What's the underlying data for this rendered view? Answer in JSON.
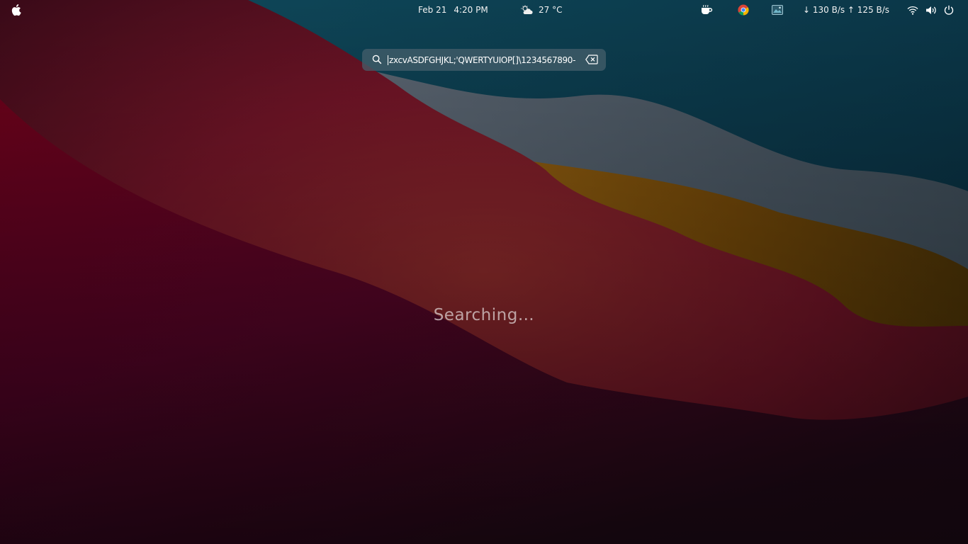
{
  "topbar": {
    "apple_menu_icon": "apple-icon",
    "date": "Feb 21",
    "time": "4:20 PM",
    "weather": {
      "icon": "partly-cloudy-icon",
      "temperature": "27 °C"
    },
    "tray_icons": [
      "coffee-cup-icon",
      "chrome-icon",
      "image-viewer-icon"
    ],
    "network_speed": "↓ 130 B/s ↑ 125 B/s",
    "system_icons": [
      "wifi-icon",
      "volume-icon",
      "power-icon"
    ]
  },
  "search": {
    "icon": "search-icon",
    "query": "zxcvASDFGHJKL;'QWERTYUIOP[]\\1234567890-",
    "clear_icon": "backspace-clear-icon"
  },
  "status_text": "Searching…",
  "colors": {
    "search_box_bg": "#3f5b66",
    "wallpaper_red": "#7a1024",
    "wallpaper_teal": "#0e3b4c",
    "wallpaper_gold": "#7a4a08"
  }
}
